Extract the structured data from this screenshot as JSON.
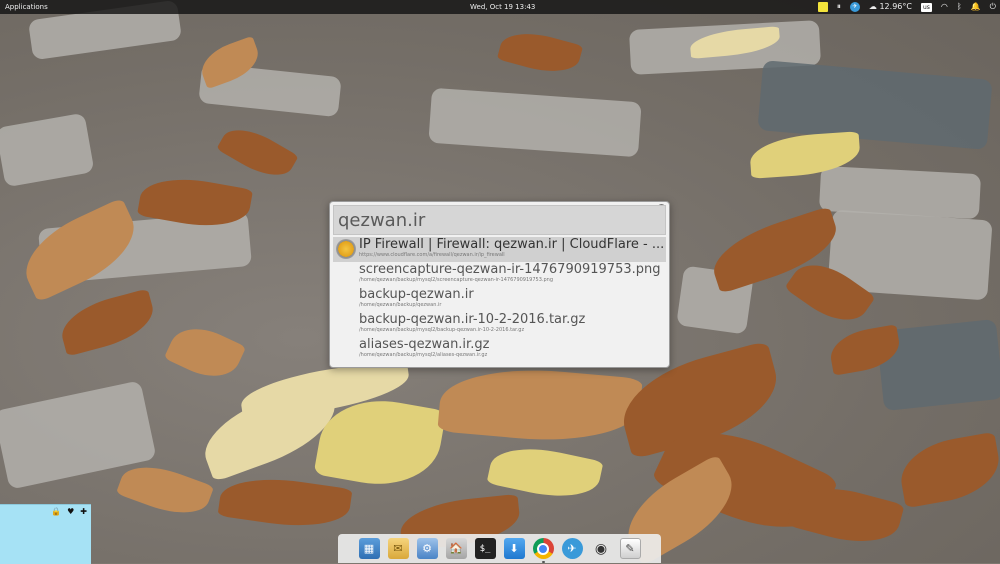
{
  "top_panel": {
    "applications_label": "Applications",
    "clock": "Wed, Oct 19   13:43",
    "weather": "12.96°C",
    "keyboard_layout": "us"
  },
  "launcher": {
    "query": "qezwan.ir",
    "results": [
      {
        "title": "IP Firewall | Firewall: qezwan.ir | CloudFlare - ...",
        "subtitle": "https://www.cloudflare.com/a/firewall/qezwan.ir/ip_firewall",
        "icon": "web-icon"
      },
      {
        "title": "screencapture-qezwan-ir-1476790919753.png",
        "subtitle": "/home/qezwan/backup/mysql2/screencapture-qezwan-ir-1476790919753.png",
        "icon": "image-file-icon"
      },
      {
        "title": "backup-qezwan.ir",
        "subtitle": "/home/qezwan/backup/qezwan.ir",
        "icon": "folder-icon"
      },
      {
        "title": "backup-qezwan.ir-10-2-2016.tar.gz",
        "subtitle": "/home/qezwan/backup/mysql2/backup-qezwan.ir-10-2-2016.tar.gz",
        "icon": "archive-icon"
      },
      {
        "title": "aliases-qezwan.ir.gz",
        "subtitle": "/home/qezwan/backup/mysql2/aliases-qezwan.ir.gz",
        "icon": "archive-icon"
      }
    ]
  },
  "note_widget": {
    "lock_glyph": "🔒",
    "heart_glyph": "♥",
    "add_glyph": "✚"
  },
  "dock": {
    "apps": [
      {
        "name": "multitasking-view",
        "glyph": "▦"
      },
      {
        "name": "mail",
        "glyph": "✉"
      },
      {
        "name": "system-settings",
        "glyph": "⚙"
      },
      {
        "name": "files",
        "glyph": "🏠"
      },
      {
        "name": "terminal",
        "glyph": "$_"
      },
      {
        "name": "downloader",
        "glyph": "⬇"
      },
      {
        "name": "chrome",
        "glyph": ""
      },
      {
        "name": "telegram",
        "glyph": "✈"
      },
      {
        "name": "webcam",
        "glyph": "◉"
      },
      {
        "name": "text-editor",
        "glyph": "✎"
      }
    ]
  },
  "colors": {
    "panel": "#141414",
    "launcher_bg": "#f1f1f1",
    "selected_row": "#d0d0d0",
    "note_bg": "#a6e2f5"
  }
}
